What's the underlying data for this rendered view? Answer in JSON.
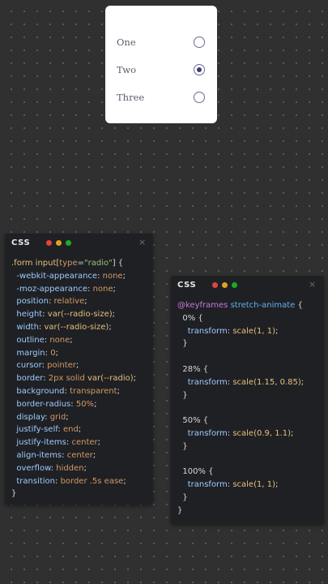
{
  "radio_form": {
    "options": [
      {
        "label": "One",
        "checked": false
      },
      {
        "label": "Two",
        "checked": true
      },
      {
        "label": "Three",
        "checked": false
      }
    ]
  },
  "panels": [
    {
      "title": "CSS",
      "close": "×",
      "lights": [
        "#e0443e",
        "#dea123",
        "#1aab29"
      ],
      "code": [
        [
          [
            ".form input[",
            "sel"
          ],
          [
            "type",
            "attr"
          ],
          [
            "=",
            "punc"
          ],
          [
            "\"radio\"",
            "str"
          ],
          [
            "] {",
            "punc"
          ]
        ],
        [
          [
            "  -webkit-appearance",
            "prop"
          ],
          [
            ": ",
            "punc"
          ],
          [
            "none",
            "val"
          ],
          [
            ";",
            "punc"
          ]
        ],
        [
          [
            "  -moz-appearance",
            "prop"
          ],
          [
            ": ",
            "punc"
          ],
          [
            "none",
            "val"
          ],
          [
            ";",
            "punc"
          ]
        ],
        [
          [
            "  position",
            "prop"
          ],
          [
            ": ",
            "punc"
          ],
          [
            "relative",
            "val"
          ],
          [
            ";",
            "punc"
          ]
        ],
        [
          [
            "  height",
            "prop"
          ],
          [
            ": ",
            "punc"
          ],
          [
            "var(--radio-size)",
            "fn"
          ],
          [
            ";",
            "punc"
          ]
        ],
        [
          [
            "  width",
            "prop"
          ],
          [
            ": ",
            "punc"
          ],
          [
            "var(--radio-size)",
            "fn"
          ],
          [
            ";",
            "punc"
          ]
        ],
        [
          [
            "  outline",
            "prop"
          ],
          [
            ": ",
            "punc"
          ],
          [
            "none",
            "val"
          ],
          [
            ";",
            "punc"
          ]
        ],
        [
          [
            "  margin",
            "prop"
          ],
          [
            ": ",
            "punc"
          ],
          [
            "0",
            "val"
          ],
          [
            ";",
            "punc"
          ]
        ],
        [
          [
            "  cursor",
            "prop"
          ],
          [
            ": ",
            "punc"
          ],
          [
            "pointer",
            "val"
          ],
          [
            ";",
            "punc"
          ]
        ],
        [
          [
            "  border",
            "prop"
          ],
          [
            ": ",
            "punc"
          ],
          [
            "2px solid ",
            "val"
          ],
          [
            "var(--radio)",
            "fn"
          ],
          [
            ";",
            "punc"
          ]
        ],
        [
          [
            "  background",
            "prop"
          ],
          [
            ": ",
            "punc"
          ],
          [
            "transparent",
            "val"
          ],
          [
            ";",
            "punc"
          ]
        ],
        [
          [
            "  border-radius",
            "prop"
          ],
          [
            ": ",
            "punc"
          ],
          [
            "50%",
            "val"
          ],
          [
            ";",
            "punc"
          ]
        ],
        [
          [
            "  display",
            "prop"
          ],
          [
            ": ",
            "punc"
          ],
          [
            "grid",
            "val"
          ],
          [
            ";",
            "punc"
          ]
        ],
        [
          [
            "  justify-self",
            "prop"
          ],
          [
            ": ",
            "punc"
          ],
          [
            "end",
            "val"
          ],
          [
            ";",
            "punc"
          ]
        ],
        [
          [
            "  justify-items",
            "prop"
          ],
          [
            ": ",
            "punc"
          ],
          [
            "center",
            "val"
          ],
          [
            ";",
            "punc"
          ]
        ],
        [
          [
            "  align-items",
            "prop"
          ],
          [
            ": ",
            "punc"
          ],
          [
            "center",
            "val"
          ],
          [
            ";",
            "punc"
          ]
        ],
        [
          [
            "  overflow",
            "prop"
          ],
          [
            ": ",
            "punc"
          ],
          [
            "hidden",
            "val"
          ],
          [
            ";",
            "punc"
          ]
        ],
        [
          [
            "  transition",
            "prop"
          ],
          [
            ": ",
            "punc"
          ],
          [
            "border .5s ease",
            "val"
          ],
          [
            ";",
            "punc"
          ]
        ],
        [
          [
            "}",
            "punc"
          ]
        ]
      ]
    },
    {
      "title": "CSS",
      "close": "×",
      "lights": [
        "#e0443e",
        "#dea123",
        "#1aab29"
      ],
      "code": [
        [
          [
            "@keyframes",
            "kw"
          ],
          [
            " ",
            "punc"
          ],
          [
            "stretch-animate",
            "name"
          ],
          [
            " {",
            "punc"
          ]
        ],
        [
          [
            "  0% {",
            "punc"
          ]
        ],
        [
          [
            "    transform",
            "prop"
          ],
          [
            ": ",
            "punc"
          ],
          [
            "scale(1, 1)",
            "fn"
          ],
          [
            ";",
            "punc"
          ]
        ],
        [
          [
            "  }",
            "punc"
          ]
        ],
        [
          [
            "",
            "punc"
          ]
        ],
        [
          [
            "  28% {",
            "punc"
          ]
        ],
        [
          [
            "    transform",
            "prop"
          ],
          [
            ": ",
            "punc"
          ],
          [
            "scale(1.15, 0.85)",
            "fn"
          ],
          [
            ";",
            "punc"
          ]
        ],
        [
          [
            "  }",
            "punc"
          ]
        ],
        [
          [
            "",
            "punc"
          ]
        ],
        [
          [
            "  50% {",
            "punc"
          ]
        ],
        [
          [
            "    transform",
            "prop"
          ],
          [
            ": ",
            "punc"
          ],
          [
            "scale(0.9, 1.1)",
            "fn"
          ],
          [
            ";",
            "punc"
          ]
        ],
        [
          [
            "  }",
            "punc"
          ]
        ],
        [
          [
            "",
            "punc"
          ]
        ],
        [
          [
            "  100% {",
            "punc"
          ]
        ],
        [
          [
            "    transform",
            "prop"
          ],
          [
            ": ",
            "punc"
          ],
          [
            "scale(1, 1)",
            "fn"
          ],
          [
            ";",
            "punc"
          ]
        ],
        [
          [
            "  }",
            "punc"
          ]
        ],
        [
          [
            "}",
            "punc"
          ]
        ]
      ]
    }
  ]
}
